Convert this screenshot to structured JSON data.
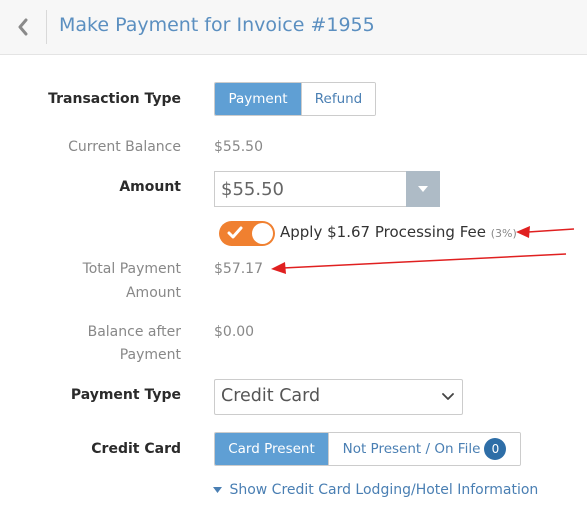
{
  "header": {
    "title": "Make Payment for Invoice #1955",
    "back_icon": "chevron-left-icon"
  },
  "transaction_type": {
    "label": "Transaction Type",
    "options": [
      "Payment",
      "Refund"
    ],
    "selected": "Payment"
  },
  "current_balance": {
    "label": "Current Balance",
    "value": "$55.50"
  },
  "amount": {
    "label": "Amount",
    "value": "$55.50"
  },
  "processing_fee": {
    "enabled": true,
    "text": "Apply $1.67 Processing Fee",
    "percent": "(3%)"
  },
  "total_payment": {
    "label_line1": "Total Payment",
    "label_line2": "Amount",
    "value": "$57.17"
  },
  "balance_after": {
    "label_line1": "Balance after",
    "label_line2": "Payment",
    "value": "$0.00"
  },
  "payment_type": {
    "label": "Payment Type",
    "value": "Credit Card"
  },
  "credit_card": {
    "label": "Credit Card",
    "options": [
      "Card Present",
      "Not Present / On File"
    ],
    "selected": "Card Present",
    "on_file_count": "0"
  },
  "lodging_link": "Show Credit Card Lodging/Hotel Information",
  "colors": {
    "accent": "#5f9fd4",
    "link": "#4a7fb3",
    "toggle": "#f08030",
    "badge": "#2e6ea7",
    "annotation_arrow": "#e02020"
  }
}
